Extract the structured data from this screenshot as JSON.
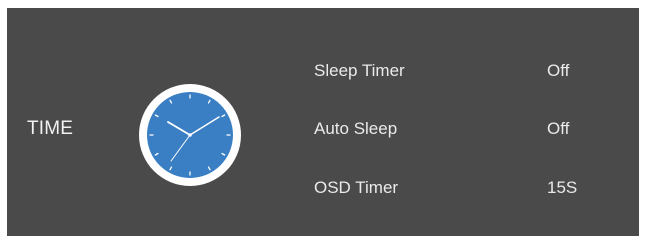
{
  "panel": {
    "category": "TIME",
    "icon": "clock-icon",
    "colors": {
      "background": "#4a4a4a",
      "clock_face": "#3a7fc4",
      "clock_ring": "#ffffff",
      "text": "#eaeaea"
    }
  },
  "menu": {
    "items": [
      {
        "label": "Sleep Timer",
        "value": "Off"
      },
      {
        "label": "Auto Sleep",
        "value": "Off"
      },
      {
        "label": "OSD Timer",
        "value": "15S"
      }
    ]
  }
}
